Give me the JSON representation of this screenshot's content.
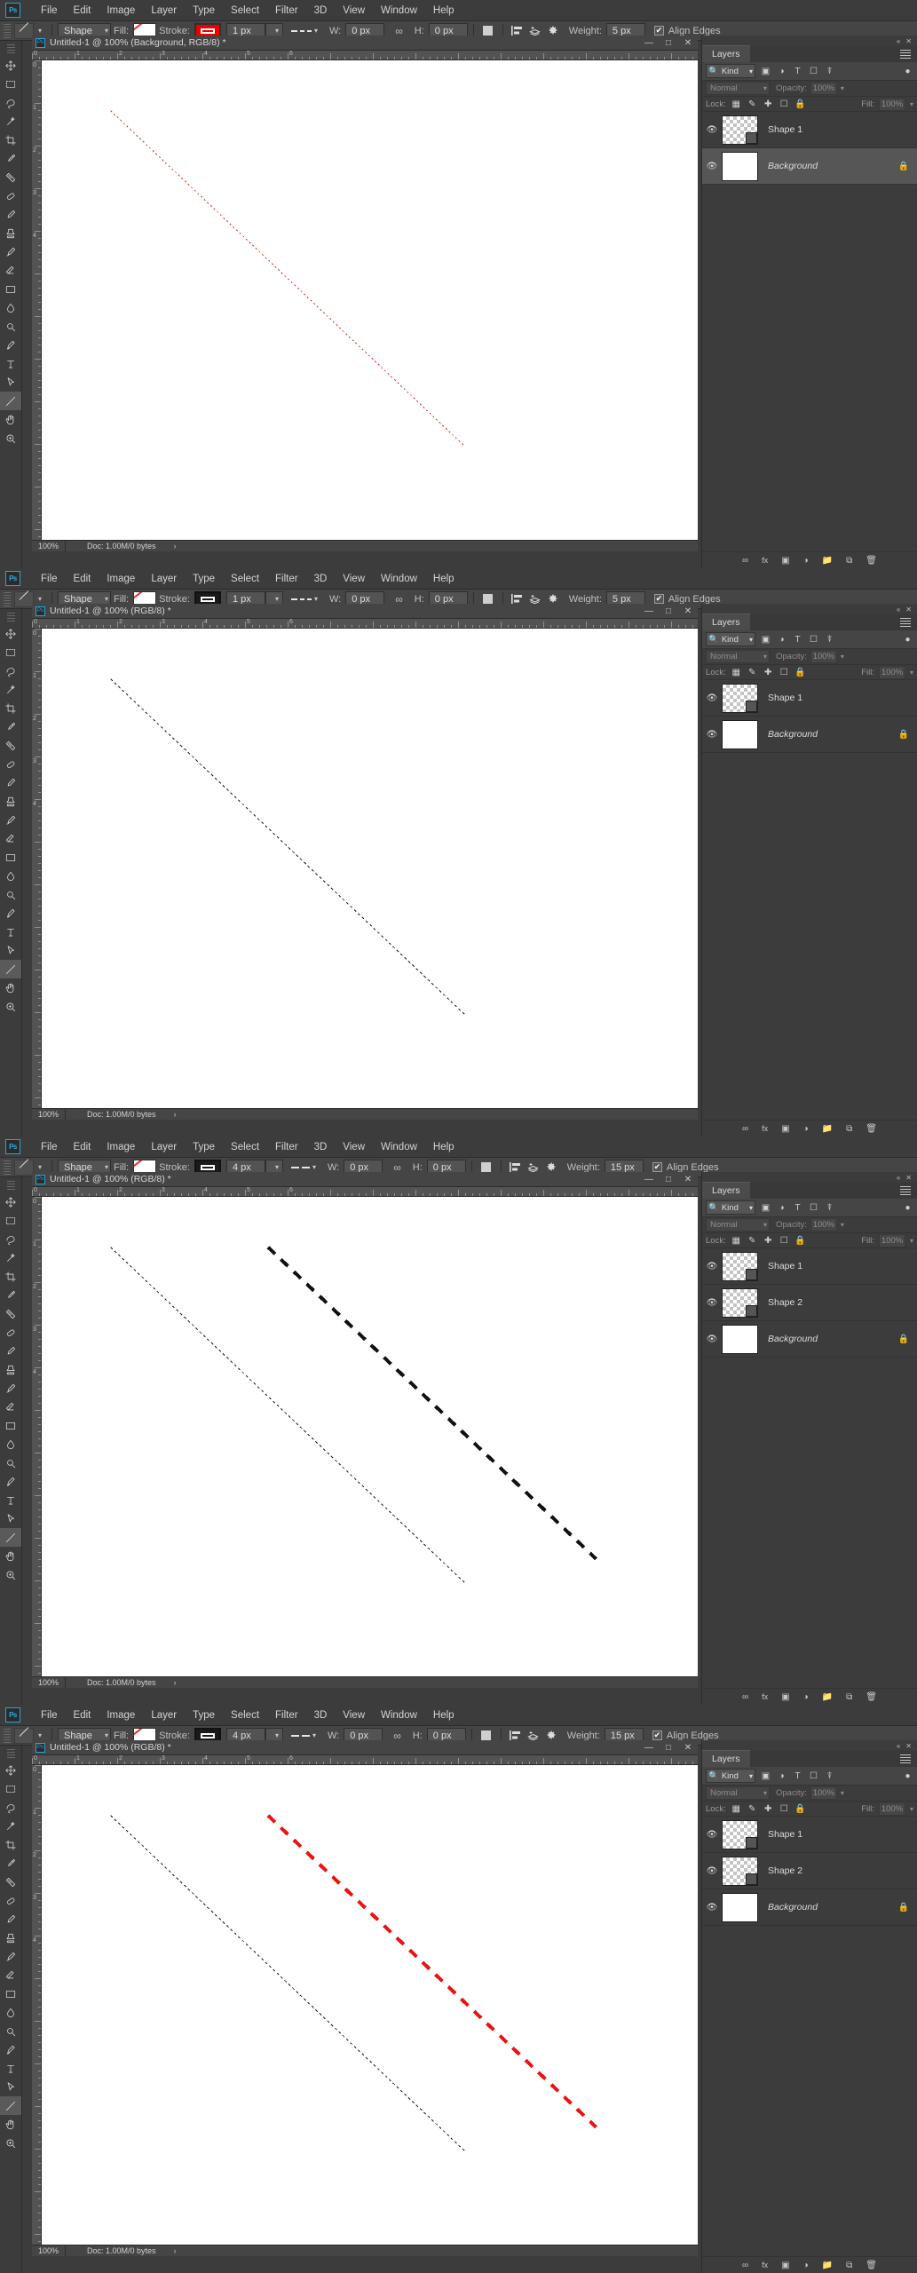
{
  "app": {
    "logo": "Ps",
    "name": "Adobe Photoshop"
  },
  "menu": {
    "items": [
      "File",
      "Edit",
      "Image",
      "Layer",
      "Type",
      "Select",
      "Filter",
      "3D",
      "View",
      "Window",
      "Help"
    ]
  },
  "options_labels": {
    "fill": "Fill:",
    "stroke": "Stroke:",
    "width": "W:",
    "height": "H:",
    "weight": "Weight:",
    "align_edges": "Align Edges",
    "shape_mode": "Shape",
    "link_icon": "link-icon",
    "check_mark": "✔"
  },
  "status_labels": {
    "doc": "Doc: 1.00M/0 bytes",
    "arrow": "›"
  },
  "layers_panel": {
    "tab": "Layers",
    "kind": "Kind",
    "blend_mode": "Normal",
    "opacity_label": "Opacity:",
    "opacity_value": "100%",
    "lock_label": "Lock:",
    "fill_label": "Fill:",
    "fill_value": "100%",
    "filter_icons": [
      "image-filter-icon",
      "adjustment-filter-icon",
      "type-filter-icon",
      "shape-filter-icon",
      "smartobject-filter-icon"
    ],
    "lock_icons": [
      "lock-transparency-icon",
      "lock-image-icon",
      "lock-position-icon",
      "lock-artboard-icon",
      "lock-all-icon"
    ],
    "footer_icons": [
      "link-layers-icon",
      "layer-style-icon",
      "layer-mask-icon",
      "adjustment-layer-icon",
      "new-group-icon",
      "new-layer-icon",
      "delete-layer-icon"
    ],
    "eye_icon": "◉",
    "lock_badge": "🔒"
  },
  "panels": [
    {
      "id": "panel-1",
      "doc_title": "Untitled-1 @ 100% (Background, RGB/8) *",
      "zoom": "100%",
      "options": {
        "shape_mode": "Shape",
        "stroke_color": "#ee0000",
        "stroke_width": "1 px",
        "w": "0 px",
        "h": "0 px",
        "weight": "5 px",
        "dash_style": "dashed-long"
      },
      "canvas": {
        "lines": [
          {
            "name": "red-dashed-diagonal",
            "color": "#ee2222",
            "dash": "2,3",
            "width": 1,
            "x1": 0.105,
            "y1": 0.105,
            "x2": 0.645,
            "y2": 0.805
          }
        ]
      },
      "layers": [
        {
          "name": "Shape 1",
          "type": "shape",
          "visible": true,
          "selected": false,
          "locked": false
        },
        {
          "name": "Background",
          "type": "background",
          "visible": true,
          "selected": true,
          "locked": true
        }
      ]
    },
    {
      "id": "panel-2",
      "doc_title": "Untitled-1 @ 100% (RGB/8) *",
      "zoom": "100%",
      "options": {
        "shape_mode": "Shape",
        "stroke_color": "#1a1a1a",
        "stroke_width": "1 px",
        "w": "0 px",
        "h": "0 px",
        "weight": "5 px",
        "dash_style": "dashed-long"
      },
      "canvas": {
        "lines": [
          {
            "name": "black-dashed-diagonal",
            "color": "#1a1a1a",
            "dash": "3,3",
            "width": 1,
            "x1": 0.105,
            "y1": 0.105,
            "x2": 0.645,
            "y2": 0.805
          }
        ]
      },
      "layers": [
        {
          "name": "Shape 1",
          "type": "shape",
          "visible": true,
          "selected": false,
          "locked": false
        },
        {
          "name": "Background",
          "type": "background",
          "visible": true,
          "selected": false,
          "locked": true
        }
      ]
    },
    {
      "id": "panel-3",
      "doc_title": "Untitled-1 @ 100% (RGB/8) *",
      "zoom": "100%",
      "options": {
        "shape_mode": "Shape",
        "stroke_color": "#1a1a1a",
        "stroke_width": "4 px",
        "w": "0 px",
        "h": "0 px",
        "weight": "15 px",
        "dash_style": "dashed-short"
      },
      "canvas": {
        "lines": [
          {
            "name": "black-thin-dashed-diagonal",
            "color": "#1a1a1a",
            "dash": "3,3",
            "width": 1,
            "x1": 0.105,
            "y1": 0.105,
            "x2": 0.645,
            "y2": 0.805
          },
          {
            "name": "black-thick-dashed-diagonal",
            "color": "#111111",
            "dash": "11,9",
            "width": 4,
            "x1": 0.345,
            "y1": 0.105,
            "x2": 0.845,
            "y2": 0.755
          }
        ]
      },
      "layers": [
        {
          "name": "Shape 1",
          "type": "shape",
          "visible": true,
          "selected": false,
          "locked": false
        },
        {
          "name": "Shape 2",
          "type": "shape",
          "visible": true,
          "selected": false,
          "locked": false
        },
        {
          "name": "Background",
          "type": "background",
          "visible": true,
          "selected": false,
          "locked": true
        }
      ]
    },
    {
      "id": "panel-4",
      "doc_title": "Untitled-1 @ 100% (RGB/8) *",
      "zoom": "100%",
      "options": {
        "shape_mode": "Shape",
        "stroke_color": "#1a1a1a",
        "stroke_width": "4 px",
        "w": "0 px",
        "h": "0 px",
        "weight": "15 px",
        "dash_style": "dashed-short"
      },
      "canvas": {
        "lines": [
          {
            "name": "black-thin-dashed-diagonal",
            "color": "#1a1a1a",
            "dash": "3,3",
            "width": 1,
            "x1": 0.105,
            "y1": 0.105,
            "x2": 0.645,
            "y2": 0.805
          },
          {
            "name": "red-thick-dashed-diagonal",
            "color": "#ee1111",
            "dash": "11,9",
            "width": 4,
            "x1": 0.345,
            "y1": 0.105,
            "x2": 0.845,
            "y2": 0.755
          }
        ]
      },
      "layers": [
        {
          "name": "Shape 1",
          "type": "shape",
          "visible": true,
          "selected": false,
          "locked": false
        },
        {
          "name": "Shape 2",
          "type": "shape",
          "visible": true,
          "selected": false,
          "locked": false
        },
        {
          "name": "Background",
          "type": "background",
          "visible": true,
          "selected": false,
          "locked": true
        }
      ]
    }
  ],
  "toolbar": {
    "tools": [
      {
        "name": "move-tool",
        "glyph": "move"
      },
      {
        "name": "marquee-tool",
        "glyph": "marquee"
      },
      {
        "name": "lasso-tool",
        "glyph": "lasso"
      },
      {
        "name": "quick-selection-tool",
        "glyph": "wand"
      },
      {
        "name": "crop-tool",
        "glyph": "crop"
      },
      {
        "name": "eyedropper-tool",
        "glyph": "eyedropper"
      },
      {
        "name": "ruler-tool",
        "glyph": "ruler"
      },
      {
        "name": "spot-healing-tool",
        "glyph": "heal"
      },
      {
        "name": "brush-tool",
        "glyph": "brush"
      },
      {
        "name": "clone-stamp-tool",
        "glyph": "stamp"
      },
      {
        "name": "history-brush-tool",
        "glyph": "historybrush"
      },
      {
        "name": "eraser-tool",
        "glyph": "eraser"
      },
      {
        "name": "gradient-tool",
        "glyph": "gradient"
      },
      {
        "name": "blur-tool",
        "glyph": "blur"
      },
      {
        "name": "dodge-tool",
        "glyph": "dodge"
      },
      {
        "name": "pen-tool",
        "glyph": "pen"
      },
      {
        "name": "type-tool",
        "glyph": "type"
      },
      {
        "name": "path-selection-tool",
        "glyph": "pathsel"
      },
      {
        "name": "line-tool",
        "glyph": "line"
      },
      {
        "name": "hand-tool",
        "glyph": "hand"
      },
      {
        "name": "zoom-tool",
        "glyph": "zoom"
      }
    ]
  },
  "ruler": {
    "h_numbers": [
      "0",
      "1",
      "2",
      "3",
      "4",
      "5",
      "6"
    ],
    "v_numbers": [
      "0",
      "1",
      "2",
      "3",
      "4"
    ]
  },
  "colors": {
    "chrome": "#3c3c3c",
    "optionbar": "#454545",
    "panel_select": "#565656",
    "accent": "#31a8e0",
    "red": "#ee0000"
  }
}
